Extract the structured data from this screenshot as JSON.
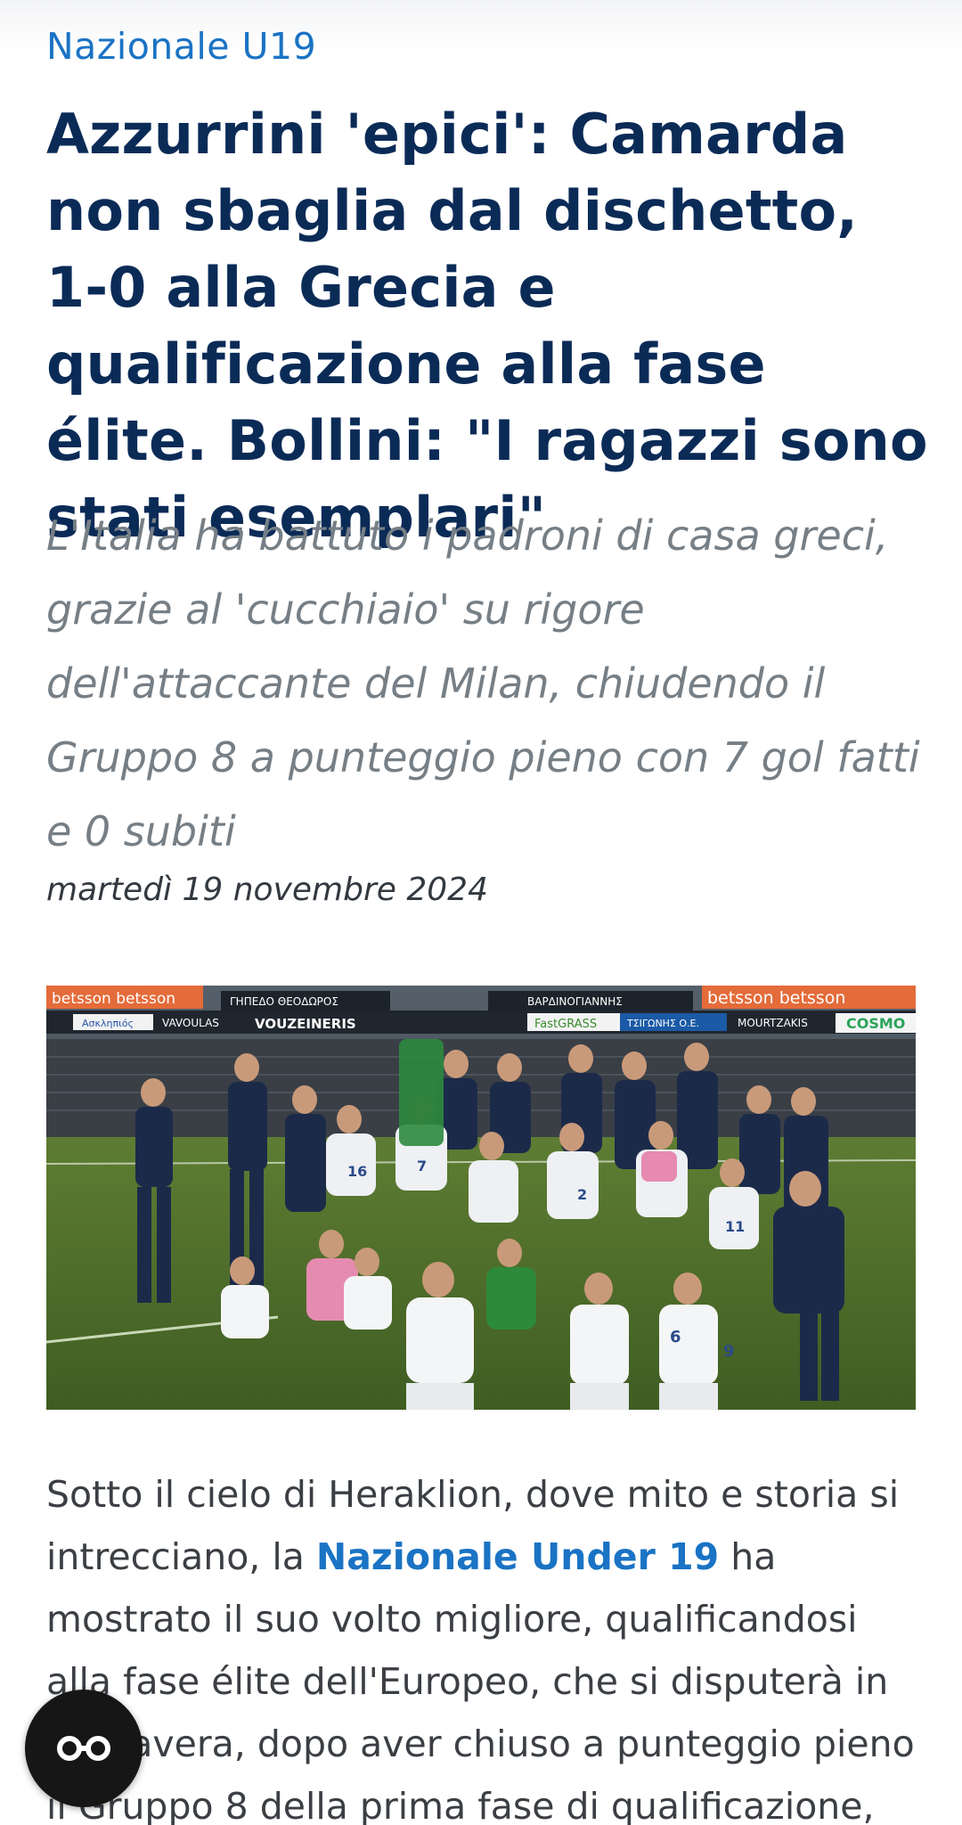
{
  "category": {
    "label": "Nazionale U19"
  },
  "article": {
    "title": "Azzurrini 'epici': Camarda non sbaglia dal dischetto, 1-0 alla Grecia e qualificazione alla fase élite. Bollini: \"I ragazzi sono stati esemplari\"",
    "subtitle": "L'Italia ha battuto i padroni di casa greci, grazie al 'cucchiaio' su rigore dell'attaccante del Milan, chiudendo il Gruppo 8 a punteggio pieno con 7 gol fatti e 0 subiti",
    "date": "martedì 19 novembre 2024",
    "body": {
      "part1": "Sotto il cielo di Heraklion, dove mito e storia si intrecciano, la ",
      "link_text": "Nazionale Under 19",
      "part2": " ha mostrato il suo volto migliore, qualificandosi alla fase élite dell'Europeo, che si disputerà in primavera, dopo aver chiuso a punteggio pieno il Gruppo 8 della prima fase di qualificazione,"
    }
  },
  "hero_image": {
    "ad_boards_top": [
      "betsson betsson",
      "ΓΗΠΕΔΟ ΘΕΟΔΩΡΟΣ",
      "ΒΑΡΔΙΝΟΓΙΑΝΝΗΣ",
      "betsson betsson"
    ],
    "ad_boards_second": [
      "Ασκληπιός",
      "VAVOULAS",
      "VOUZEINERIS",
      "FastGRASS",
      "ΤΣΙΓΩΝΗΣ Ο.Ε.",
      "MOURTZAKIS",
      "COSMO"
    ],
    "shirt_numbers": [
      "16",
      "7",
      "2",
      "11",
      "6",
      "9"
    ]
  },
  "fab": {
    "icon": "glasses-icon"
  },
  "colors": {
    "accent": "#1a73c4",
    "headline": "#0b2b57",
    "subtitle": "#767f86",
    "body": "#3b3f44",
    "fab": "#161616"
  }
}
